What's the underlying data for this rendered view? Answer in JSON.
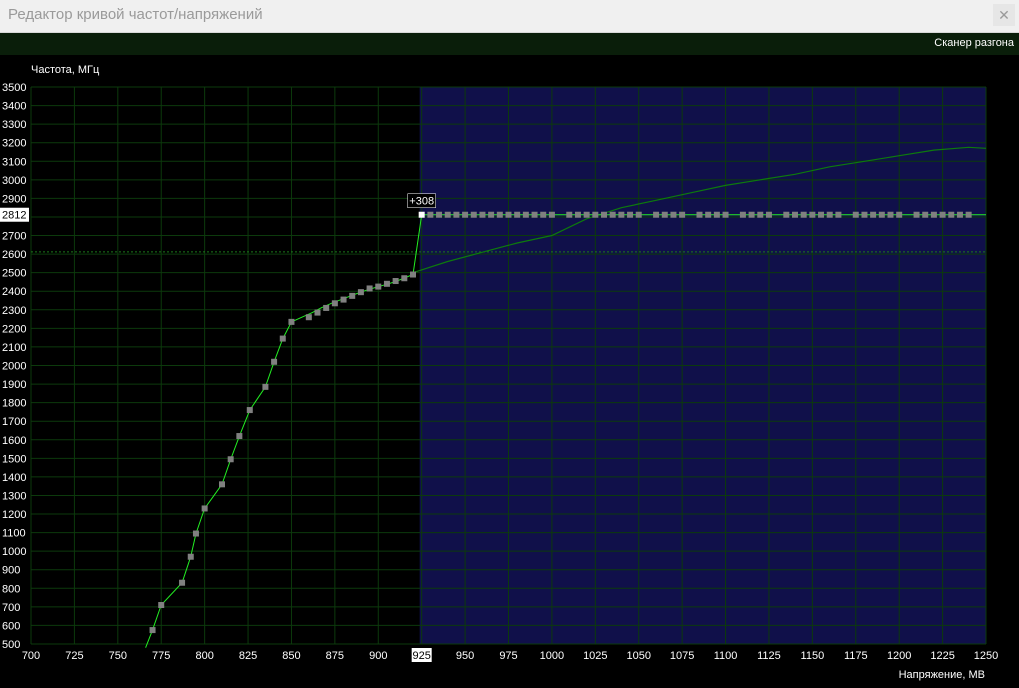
{
  "window": {
    "title": "Редактор кривой частот/напряжений",
    "close_icon": "close-icon"
  },
  "toolbar": {
    "scanner_label": "Сканер разгона"
  },
  "colors": {
    "curve": "#22ee22",
    "marker": "#808080",
    "selected_marker": "#ffffff",
    "locked_region": "#10104a",
    "grid": "#0c3a0c",
    "background": "#000000",
    "reference_curve": "#0d7a0d"
  },
  "chart_data": {
    "type": "line",
    "ylabel": "Частота, МГц",
    "xlabel": "Напряжение, МВ",
    "xlim": [
      700,
      1250
    ],
    "ylim": [
      500,
      3500
    ],
    "x_ticks": [
      700,
      725,
      750,
      775,
      800,
      825,
      850,
      875,
      900,
      925,
      950,
      975,
      1000,
      1025,
      1050,
      1075,
      1100,
      1125,
      1150,
      1175,
      1200,
      1225,
      1250
    ],
    "y_ticks": [
      3500,
      3400,
      3300,
      3200,
      3100,
      3000,
      2900,
      2800,
      2700,
      2600,
      2500,
      2400,
      2300,
      2200,
      2100,
      2000,
      1900,
      1800,
      1700,
      1600,
      1500,
      1400,
      1300,
      1200,
      1100,
      1000,
      900,
      800,
      700,
      600,
      500
    ],
    "locked_voltage": 925,
    "locked_frequency": 2812,
    "offset_label": "+308",
    "reference_hline": 2612,
    "grid": true,
    "series": [
      {
        "role": "curve",
        "x": [
          766,
          770,
          775,
          787,
          792,
          795,
          800,
          805,
          810,
          815,
          820,
          823,
          826,
          830,
          835,
          840,
          845,
          850,
          856,
          862,
          867,
          873,
          880,
          887,
          893,
          900,
          906,
          912,
          920,
          925,
          930,
          935,
          940,
          945,
          950,
          955,
          960,
          965,
          970,
          975,
          980,
          985,
          990,
          995,
          1000,
          1005,
          1010,
          1015,
          1020,
          1025,
          1030,
          1035,
          1040,
          1045,
          1050,
          1055,
          1060,
          1065,
          1070,
          1075,
          1080,
          1085,
          1090,
          1095,
          1100,
          1105,
          1110,
          1115,
          1120,
          1125,
          1130,
          1135,
          1140,
          1145,
          1150,
          1155,
          1160,
          1165,
          1170,
          1175,
          1180,
          1185,
          1190,
          1195,
          1200,
          1205,
          1210,
          1215,
          1220,
          1225,
          1230,
          1235,
          1240,
          1245,
          1250
        ],
        "y": [
          480,
          575,
          710,
          830,
          970,
          1095,
          1230,
          1295,
          1360,
          1495,
          1620,
          1690,
          1760,
          1815,
          1885,
          2020,
          2145,
          2235,
          2260,
          2285,
          2310,
          2335,
          2360,
          2385,
          2405,
          2425,
          2440,
          2460,
          2490,
          2812,
          2812,
          2812,
          2812,
          2812,
          2812,
          2812,
          2812,
          2812,
          2812,
          2812,
          2812,
          2812,
          2812,
          2812,
          2812,
          2812,
          2812,
          2812,
          2812,
          2812,
          2812,
          2812,
          2812,
          2812,
          2812,
          2812,
          2812,
          2812,
          2812,
          2812,
          2812,
          2812,
          2812,
          2812,
          2812,
          2812,
          2812,
          2812,
          2812,
          2812,
          2812,
          2812,
          2812,
          2812,
          2812,
          2812,
          2812,
          2812,
          2812,
          2812,
          2812,
          2812,
          2812,
          2812,
          2812,
          2812,
          2812,
          2812,
          2812,
          2812,
          2812,
          2812,
          2812,
          2812,
          2812
        ],
        "markers_x": [
          770,
          775,
          787,
          792,
          795,
          800,
          810,
          815,
          820,
          826,
          835,
          840,
          845,
          850,
          860,
          865,
          870,
          875,
          880,
          885,
          890,
          895,
          900,
          905,
          910,
          915,
          920,
          925,
          930,
          935,
          940,
          945,
          950,
          955,
          960,
          965,
          970,
          975,
          980,
          985,
          990,
          995,
          1000,
          1010,
          1015,
          1020,
          1025,
          1030,
          1035,
          1040,
          1045,
          1050,
          1060,
          1065,
          1070,
          1075,
          1085,
          1090,
          1095,
          1100,
          1110,
          1115,
          1120,
          1125,
          1135,
          1140,
          1145,
          1150,
          1155,
          1160,
          1165,
          1175,
          1180,
          1185,
          1190,
          1195,
          1200,
          1210,
          1215,
          1220,
          1225,
          1230,
          1235,
          1240
        ],
        "markers_y": [
          575,
          710,
          830,
          970,
          1095,
          1230,
          1360,
          1495,
          1620,
          1760,
          1885,
          2020,
          2145,
          2235,
          2260,
          2285,
          2310,
          2335,
          2355,
          2375,
          2395,
          2415,
          2425,
          2440,
          2455,
          2470,
          2490,
          2812,
          2812,
          2812,
          2812,
          2812,
          2812,
          2812,
          2812,
          2812,
          2812,
          2812,
          2812,
          2812,
          2812,
          2812,
          2812,
          2812,
          2812,
          2812,
          2812,
          2812,
          2812,
          2812,
          2812,
          2812,
          2812,
          2812,
          2812,
          2812,
          2812,
          2812,
          2812,
          2812,
          2812,
          2812,
          2812,
          2812,
          2812,
          2812,
          2812,
          2812,
          2812,
          2812,
          2812,
          2812,
          2812,
          2812,
          2812,
          2812,
          2812,
          2812,
          2812,
          2812,
          2812,
          2812,
          2812,
          2812
        ]
      },
      {
        "role": "reference",
        "x": [
          920,
          940,
          960,
          980,
          1000,
          1020,
          1040,
          1060,
          1080,
          1100,
          1120,
          1140,
          1160,
          1180,
          1200,
          1220,
          1240,
          1250
        ],
        "y": [
          2500,
          2560,
          2610,
          2660,
          2700,
          2790,
          2850,
          2890,
          2930,
          2970,
          3000,
          3030,
          3070,
          3100,
          3130,
          3160,
          3175,
          3170
        ]
      }
    ]
  }
}
